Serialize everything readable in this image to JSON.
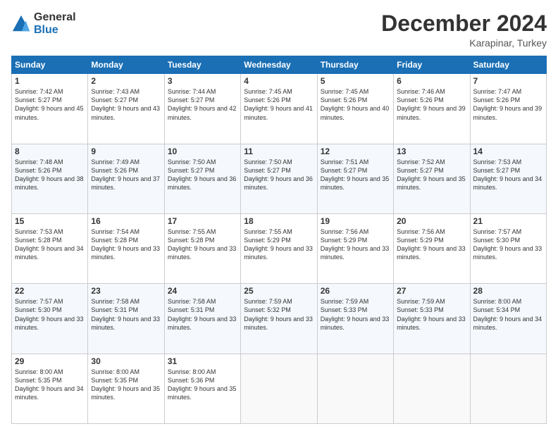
{
  "header": {
    "logo_line1": "General",
    "logo_line2": "Blue",
    "month": "December 2024",
    "location": "Karapinar, Turkey"
  },
  "weekdays": [
    "Sunday",
    "Monday",
    "Tuesday",
    "Wednesday",
    "Thursday",
    "Friday",
    "Saturday"
  ],
  "weeks": [
    [
      {
        "day": "1",
        "rise": "7:42 AM",
        "set": "5:27 PM",
        "daylight": "9 hours and 45 minutes."
      },
      {
        "day": "2",
        "rise": "7:43 AM",
        "set": "5:27 PM",
        "daylight": "9 hours and 43 minutes."
      },
      {
        "day": "3",
        "rise": "7:44 AM",
        "set": "5:27 PM",
        "daylight": "9 hours and 42 minutes."
      },
      {
        "day": "4",
        "rise": "7:45 AM",
        "set": "5:26 PM",
        "daylight": "9 hours and 41 minutes."
      },
      {
        "day": "5",
        "rise": "7:45 AM",
        "set": "5:26 PM",
        "daylight": "9 hours and 40 minutes."
      },
      {
        "day": "6",
        "rise": "7:46 AM",
        "set": "5:26 PM",
        "daylight": "9 hours and 39 minutes."
      },
      {
        "day": "7",
        "rise": "7:47 AM",
        "set": "5:26 PM",
        "daylight": "9 hours and 39 minutes."
      }
    ],
    [
      {
        "day": "8",
        "rise": "7:48 AM",
        "set": "5:26 PM",
        "daylight": "9 hours and 38 minutes."
      },
      {
        "day": "9",
        "rise": "7:49 AM",
        "set": "5:26 PM",
        "daylight": "9 hours and 37 minutes."
      },
      {
        "day": "10",
        "rise": "7:50 AM",
        "set": "5:27 PM",
        "daylight": "9 hours and 36 minutes."
      },
      {
        "day": "11",
        "rise": "7:50 AM",
        "set": "5:27 PM",
        "daylight": "9 hours and 36 minutes."
      },
      {
        "day": "12",
        "rise": "7:51 AM",
        "set": "5:27 PM",
        "daylight": "9 hours and 35 minutes."
      },
      {
        "day": "13",
        "rise": "7:52 AM",
        "set": "5:27 PM",
        "daylight": "9 hours and 35 minutes."
      },
      {
        "day": "14",
        "rise": "7:53 AM",
        "set": "5:27 PM",
        "daylight": "9 hours and 34 minutes."
      }
    ],
    [
      {
        "day": "15",
        "rise": "7:53 AM",
        "set": "5:28 PM",
        "daylight": "9 hours and 34 minutes."
      },
      {
        "day": "16",
        "rise": "7:54 AM",
        "set": "5:28 PM",
        "daylight": "9 hours and 33 minutes."
      },
      {
        "day": "17",
        "rise": "7:55 AM",
        "set": "5:28 PM",
        "daylight": "9 hours and 33 minutes."
      },
      {
        "day": "18",
        "rise": "7:55 AM",
        "set": "5:29 PM",
        "daylight": "9 hours and 33 minutes."
      },
      {
        "day": "19",
        "rise": "7:56 AM",
        "set": "5:29 PM",
        "daylight": "9 hours and 33 minutes."
      },
      {
        "day": "20",
        "rise": "7:56 AM",
        "set": "5:29 PM",
        "daylight": "9 hours and 33 minutes."
      },
      {
        "day": "21",
        "rise": "7:57 AM",
        "set": "5:30 PM",
        "daylight": "9 hours and 33 minutes."
      }
    ],
    [
      {
        "day": "22",
        "rise": "7:57 AM",
        "set": "5:30 PM",
        "daylight": "9 hours and 33 minutes."
      },
      {
        "day": "23",
        "rise": "7:58 AM",
        "set": "5:31 PM",
        "daylight": "9 hours and 33 minutes."
      },
      {
        "day": "24",
        "rise": "7:58 AM",
        "set": "5:31 PM",
        "daylight": "9 hours and 33 minutes."
      },
      {
        "day": "25",
        "rise": "7:59 AM",
        "set": "5:32 PM",
        "daylight": "9 hours and 33 minutes."
      },
      {
        "day": "26",
        "rise": "7:59 AM",
        "set": "5:33 PM",
        "daylight": "9 hours and 33 minutes."
      },
      {
        "day": "27",
        "rise": "7:59 AM",
        "set": "5:33 PM",
        "daylight": "9 hours and 33 minutes."
      },
      {
        "day": "28",
        "rise": "8:00 AM",
        "set": "5:34 PM",
        "daylight": "9 hours and 34 minutes."
      }
    ],
    [
      {
        "day": "29",
        "rise": "8:00 AM",
        "set": "5:35 PM",
        "daylight": "9 hours and 34 minutes."
      },
      {
        "day": "30",
        "rise": "8:00 AM",
        "set": "5:35 PM",
        "daylight": "9 hours and 35 minutes."
      },
      {
        "day": "31",
        "rise": "8:00 AM",
        "set": "5:36 PM",
        "daylight": "9 hours and 35 minutes."
      },
      null,
      null,
      null,
      null
    ]
  ]
}
